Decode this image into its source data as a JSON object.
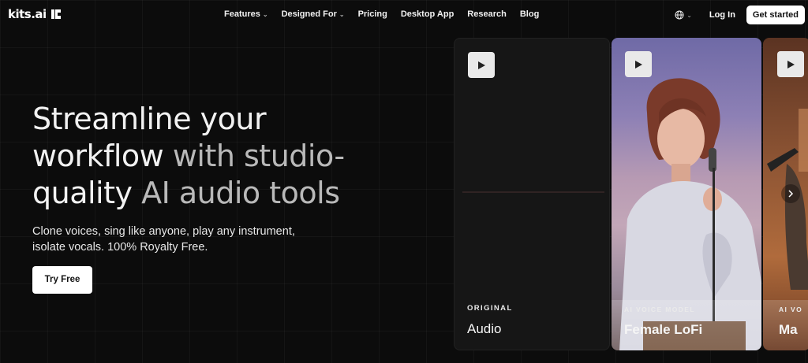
{
  "brand": {
    "name": "kits.ai"
  },
  "nav": {
    "items": [
      {
        "label": "Features",
        "has_dropdown": true
      },
      {
        "label": "Designed For",
        "has_dropdown": true
      },
      {
        "label": "Pricing",
        "has_dropdown": false
      },
      {
        "label": "Desktop App",
        "has_dropdown": false
      },
      {
        "label": "Research",
        "has_dropdown": false
      },
      {
        "label": "Blog",
        "has_dropdown": false
      }
    ],
    "login": "Log In",
    "cta": "Get started",
    "language_icon": "globe-icon"
  },
  "hero": {
    "headline_line1": "Streamline your",
    "headline_line2_bright": "workflow",
    "headline_line2_dim": " with studio-",
    "headline_line3_bright": "quality",
    "headline_line3_dim": " AI audio tools",
    "subtitle_line1": "Clone voices, sing like anyone, play any instrument,",
    "subtitle_line2": "isolate vocals. 100% Royalty Free.",
    "button": "Try Free"
  },
  "cards": [
    {
      "label": "ORIGINAL",
      "title": "Audio",
      "icon": "play-icon"
    },
    {
      "label": "AI VOICE MODEL",
      "title": "Female LoFi",
      "icon": "play-icon"
    },
    {
      "label": "AI VO",
      "title": "Ma",
      "icon": "play-icon"
    }
  ],
  "colors": {
    "background": "#0c0c0c",
    "cta_bg": "#ffffff",
    "text": "#ffffff"
  }
}
